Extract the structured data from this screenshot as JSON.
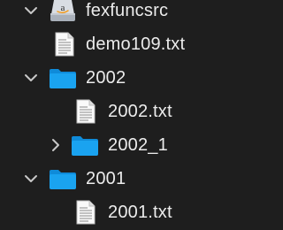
{
  "file_tree": {
    "items": [
      {
        "name": "fexfuncsrc",
        "type": "drive",
        "depth": 0,
        "disclosure": "expanded"
      },
      {
        "name": "demo109.txt",
        "type": "text-file",
        "depth": 1,
        "disclosure": "none"
      },
      {
        "name": "2002",
        "type": "folder",
        "depth": 1,
        "disclosure": "expanded"
      },
      {
        "name": "2002.txt",
        "type": "text-file",
        "depth": 2,
        "disclosure": "none"
      },
      {
        "name": "2002_1",
        "type": "folder",
        "depth": 2,
        "disclosure": "collapsed"
      },
      {
        "name": "2001",
        "type": "folder",
        "depth": 1,
        "disclosure": "expanded"
      },
      {
        "name": "2001.txt",
        "type": "text-file",
        "depth": 2,
        "disclosure": "none"
      }
    ]
  },
  "colors": {
    "background": "#1e1e1e",
    "text": "#ececec",
    "folder": "#1aa3f0",
    "disclosure": "#c8c8c8"
  }
}
